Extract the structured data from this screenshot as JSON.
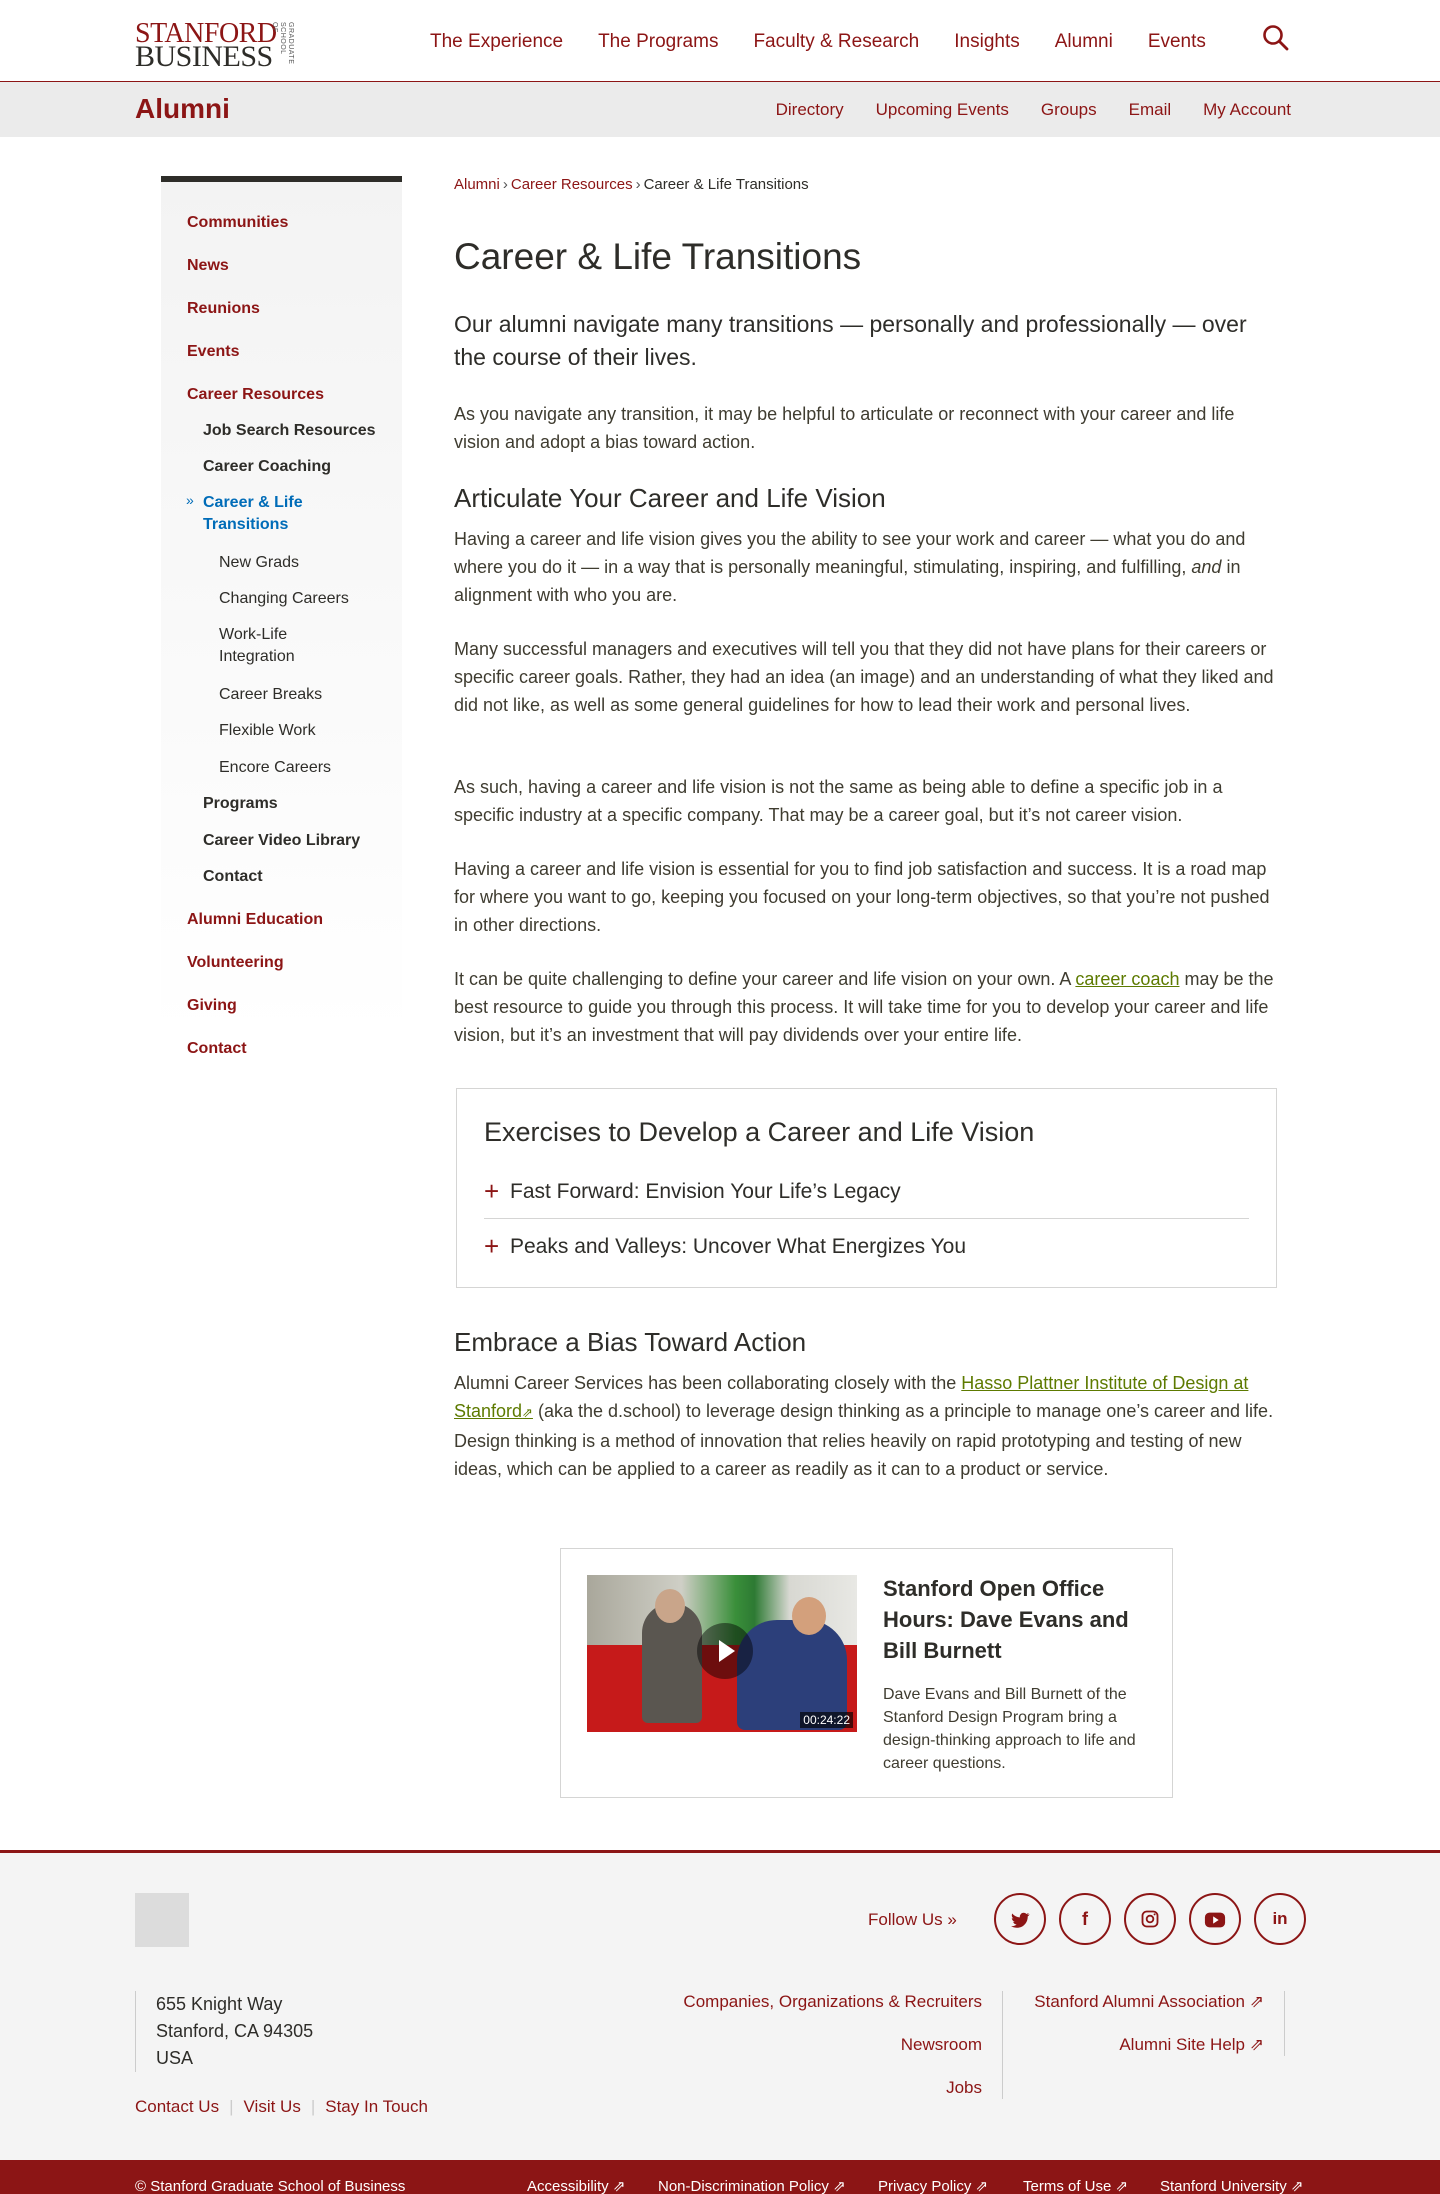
{
  "header": {
    "logo": {
      "line1": "STANFORD",
      "line2": "BUSINESS",
      "side": "GRADUATE SCHOOL OF"
    },
    "nav": [
      "The Experience",
      "The Programs",
      "Faculty & Research",
      "Insights",
      "Alumni",
      "Events"
    ]
  },
  "alumni_bar": {
    "title": "Alumni",
    "nav": [
      "Directory",
      "Upcoming Events",
      "Groups",
      "Email",
      "My Account"
    ]
  },
  "sidebar": {
    "items": [
      {
        "label": "Communities"
      },
      {
        "label": "News"
      },
      {
        "label": "Reunions"
      },
      {
        "label": "Events"
      },
      {
        "label": "Career Resources"
      },
      {
        "label": "Job Search Resources"
      },
      {
        "label": "Career Coaching"
      },
      {
        "label": "Career & Life Transitions"
      },
      {
        "label": "New Grads"
      },
      {
        "label": "Changing Careers"
      },
      {
        "label": "Work-Life Integration"
      },
      {
        "label": "Career Breaks"
      },
      {
        "label": "Flexible Work"
      },
      {
        "label": "Encore Careers"
      },
      {
        "label": "Programs"
      },
      {
        "label": "Career Video Library"
      },
      {
        "label": "Contact"
      },
      {
        "label": "Alumni Education"
      },
      {
        "label": "Volunteering"
      },
      {
        "label": "Giving"
      },
      {
        "label": "Contact"
      }
    ]
  },
  "breadcrumb": {
    "items": [
      "Alumni",
      "Career Resources",
      "Career & Life Transitions"
    ],
    "separator": "›"
  },
  "main": {
    "title": "Career & Life Transitions",
    "lead": "Our alumni navigate many transitions — personally and professionally — over the course of their lives.",
    "intro": "As you navigate any transition, it may be helpful to articulate or reconnect with your career and life vision and adopt a bias toward action.",
    "section1": {
      "heading": "Articulate Your Career and Life Vision",
      "p1_a": "Having a career and life vision gives you the ability to see your work and career — what you do and where you do it — in a way that is personally meaningful, stimulating, inspiring, and fulfilling, ",
      "p1_em": "and",
      "p1_b": " in alignment with who you are.",
      "p2": "Many successful managers and executives will tell you that they did not have plans for their careers or specific career goals. Rather, they had  an idea (an image) and an understanding of what they liked and did not like, as well as some general guidelines for how to lead their work and personal lives.",
      "p3": "As such, having a career and life vision is not the same as being able  to define a specific job in a specific industry at a specific company. That may be a career goal, but it’s not career vision.",
      "p4": "Having a career and life vision is essential for you to find job satisfaction and success. It is a road map for where you want to go, keeping you focused on your long-term objectives, so that you’re not pushed in other directions.",
      "p5_a": "It can be quite challenging to define your career and life vision on your own. A ",
      "p5_link": "career coach",
      "p5_b": " may be the best resource to guide you through this process. It will take time for you to develop your career and life vision, but it’s an investment that will pay dividends over your entire life."
    },
    "exercises": {
      "heading": "Exercises to Develop a Career and Life Vision",
      "items": [
        "Fast Forward: Envision Your Life’s Legacy",
        "Peaks and Valleys: Uncover What Energizes You"
      ]
    },
    "section2": {
      "heading": "Embrace a Bias Toward Action",
      "p_a": "Alumni Career Services has been collaborating closely with the ",
      "p_link": "Hasso Plattner Institute of Design at Stanford",
      "p_b": " (aka the d.school) to leverage design thinking as a principle to manage one’s career and life. Design thinking is a method of innovation that relies heavily on rapid prototyping and testing of new ideas, which can be applied to a career as readily as it can to a product or service."
    },
    "video": {
      "title": "Stanford Open Office Hours: Dave Evans and Bill Burnett",
      "description": "Dave Evans and Bill Burnett of the Stanford Design Program bring a design-thinking approach to life and career questions.",
      "duration": "00:24:22"
    }
  },
  "footer": {
    "follow": "Follow Us",
    "social": [
      "twitter-icon",
      "facebook-icon",
      "instagram-icon",
      "youtube-icon",
      "linkedin-icon"
    ],
    "address": [
      "655 Knight Way",
      "Stanford, CA 94305",
      "USA"
    ],
    "links_mid": [
      "Companies, Organizations & Recruiters",
      "Newsroom",
      "Jobs"
    ],
    "links_right": [
      "Stanford Alumni Association",
      "Alumni Site Help"
    ],
    "bottom_links": [
      "Contact Us",
      "Visit Us",
      "Stay In Touch"
    ],
    "copyright": "© Stanford Graduate School of Business",
    "legal_links": [
      "Accessibility",
      "Non-Discrimination Policy",
      "Privacy Policy",
      "Terms of Use",
      "Stanford University"
    ]
  },
  "colors": {
    "brand": "#8c1515",
    "link_green": "#5d7a00",
    "active_blue": "#006cb8"
  }
}
